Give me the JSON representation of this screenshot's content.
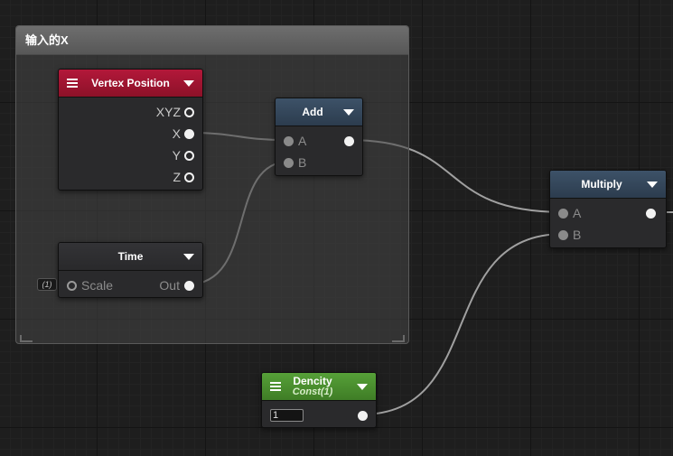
{
  "group": {
    "title": "输入的X"
  },
  "nodes": {
    "vertex_position": {
      "title": "Vertex Position",
      "outputs": [
        "XYZ",
        "X",
        "Y",
        "Z"
      ]
    },
    "time": {
      "title": "Time",
      "input_default": "(1)",
      "input_label": "Scale",
      "output_label": "Out"
    },
    "add": {
      "title": "Add",
      "inputs": [
        "A",
        "B"
      ]
    },
    "multiply": {
      "title": "Multiply",
      "inputs": [
        "A",
        "B"
      ]
    },
    "dencity": {
      "title": "Dencity",
      "subtitle": "Const(1)",
      "value": "1"
    }
  },
  "colors": {
    "background": "#1e1e1e",
    "vertex_header": "#b3183a",
    "math_header": "#3d5268",
    "const_header": "#56a038",
    "wire": "#9a9a9a"
  }
}
